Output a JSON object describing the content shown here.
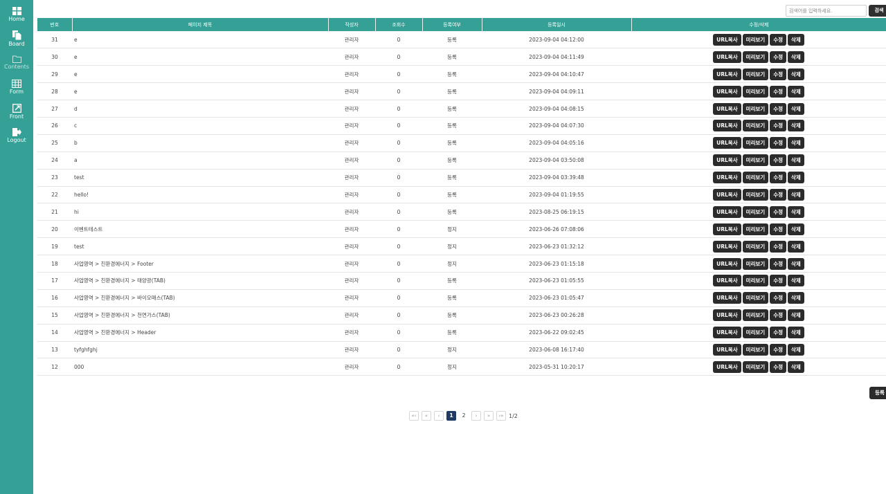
{
  "sidebar": {
    "items": [
      {
        "label": "Home",
        "icon": "grid-icon"
      },
      {
        "label": "Board",
        "icon": "documents-icon"
      },
      {
        "label": "Contents",
        "icon": "folder-icon"
      },
      {
        "label": "Form",
        "icon": "table-icon"
      },
      {
        "label": "Front",
        "icon": "external-link-icon"
      },
      {
        "label": "Logout",
        "icon": "logout-icon"
      }
    ]
  },
  "search": {
    "placeholder": "검색어를 입력하세요.",
    "button_label": "검색"
  },
  "table": {
    "headers": [
      "번호",
      "페이지 제목",
      "작성자",
      "조회수",
      "등록여부",
      "등록일시",
      "수정/삭제"
    ],
    "action_labels": {
      "url": "URL복사",
      "preview": "미리보기",
      "edit": "수정",
      "delete": "삭제"
    },
    "rows": [
      {
        "no": "31",
        "title": "e",
        "author": "관리자",
        "views": "0",
        "status": "등록",
        "date": "2023-09-04 04:12:00"
      },
      {
        "no": "30",
        "title": "e",
        "author": "관리자",
        "views": "0",
        "status": "등록",
        "date": "2023-09-04 04:11:49"
      },
      {
        "no": "29",
        "title": "e",
        "author": "관리자",
        "views": "0",
        "status": "등록",
        "date": "2023-09-04 04:10:47"
      },
      {
        "no": "28",
        "title": "e",
        "author": "관리자",
        "views": "0",
        "status": "등록",
        "date": "2023-09-04 04:09:11"
      },
      {
        "no": "27",
        "title": "d",
        "author": "관리자",
        "views": "0",
        "status": "등록",
        "date": "2023-09-04 04:08:15"
      },
      {
        "no": "26",
        "title": "c",
        "author": "관리자",
        "views": "0",
        "status": "등록",
        "date": "2023-09-04 04:07:30"
      },
      {
        "no": "25",
        "title": "b",
        "author": "관리자",
        "views": "0",
        "status": "등록",
        "date": "2023-09-04 04:05:16"
      },
      {
        "no": "24",
        "title": "a",
        "author": "관리자",
        "views": "0",
        "status": "등록",
        "date": "2023-09-04 03:50:08"
      },
      {
        "no": "23",
        "title": "test",
        "author": "관리자",
        "views": "0",
        "status": "등록",
        "date": "2023-09-04 03:39:48"
      },
      {
        "no": "22",
        "title": "hello!",
        "author": "관리자",
        "views": "0",
        "status": "등록",
        "date": "2023-09-04 01:19:55"
      },
      {
        "no": "21",
        "title": "hi",
        "author": "관리자",
        "views": "0",
        "status": "등록",
        "date": "2023-08-25 06:19:15"
      },
      {
        "no": "20",
        "title": "이벤트테스트",
        "author": "관리자",
        "views": "0",
        "status": "정지",
        "date": "2023-06-26 07:08:06"
      },
      {
        "no": "19",
        "title": "test",
        "author": "관리자",
        "views": "0",
        "status": "정지",
        "date": "2023-06-23 01:32:12"
      },
      {
        "no": "18",
        "title": "사업영역 > 친환경에너지 > Footer",
        "author": "관리자",
        "views": "0",
        "status": "정지",
        "date": "2023-06-23 01:15:18"
      },
      {
        "no": "17",
        "title": "사업영역 > 친환경에너지 > 태양광(TAB)",
        "author": "관리자",
        "views": "0",
        "status": "등록",
        "date": "2023-06-23 01:05:55"
      },
      {
        "no": "16",
        "title": "사업영역 > 친환경에너지 > 바이오매스(TAB)",
        "author": "관리자",
        "views": "0",
        "status": "등록",
        "date": "2023-06-23 01:05:47"
      },
      {
        "no": "15",
        "title": "사업영역 > 친환경에너지 > 천연가스(TAB)",
        "author": "관리자",
        "views": "0",
        "status": "등록",
        "date": "2023-06-23 00:26:28"
      },
      {
        "no": "14",
        "title": "사업영역 > 친환경에너지 > Header",
        "author": "관리자",
        "views": "0",
        "status": "등록",
        "date": "2023-06-22 09:02:45"
      },
      {
        "no": "13",
        "title": "tyfghfghj",
        "author": "관리자",
        "views": "0",
        "status": "정지",
        "date": "2023-06-08 16:17:40"
      },
      {
        "no": "12",
        "title": "000",
        "author": "관리자",
        "views": "0",
        "status": "정지",
        "date": "2023-05-31 10:20:17"
      }
    ]
  },
  "register_button_label": "등록",
  "pagination": {
    "first": "«‹",
    "prev_block": "«",
    "prev": "‹",
    "pages": [
      "1",
      "2"
    ],
    "current_page": "1",
    "next": "›",
    "next_block": "»",
    "last": "›»",
    "total": "1/2"
  },
  "colors": {
    "accent": "#35a096",
    "button": "#2b2b2b",
    "active_page": "#1f3a63"
  }
}
